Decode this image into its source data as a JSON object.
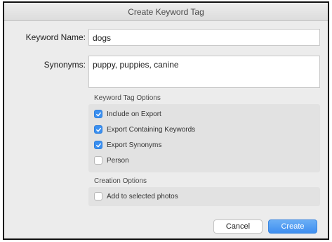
{
  "dialog": {
    "title": "Create Keyword Tag"
  },
  "fields": {
    "keyword_name_label": "Keyword Name:",
    "keyword_name_value": "dogs",
    "synonyms_label": "Synonyms:",
    "synonyms_value": "puppy, puppies, canine"
  },
  "keyword_tag_options": {
    "title": "Keyword Tag Options",
    "items": [
      {
        "label": "Include on Export",
        "checked": true
      },
      {
        "label": "Export Containing Keywords",
        "checked": true
      },
      {
        "label": "Export Synonyms",
        "checked": true
      },
      {
        "label": "Person",
        "checked": false
      }
    ]
  },
  "creation_options": {
    "title": "Creation Options",
    "items": [
      {
        "label": "Add to selected photos",
        "checked": false
      }
    ]
  },
  "buttons": {
    "cancel": "Cancel",
    "create": "Create"
  },
  "colors": {
    "accent": "#3a8ff0",
    "window_bg": "#ececec"
  }
}
